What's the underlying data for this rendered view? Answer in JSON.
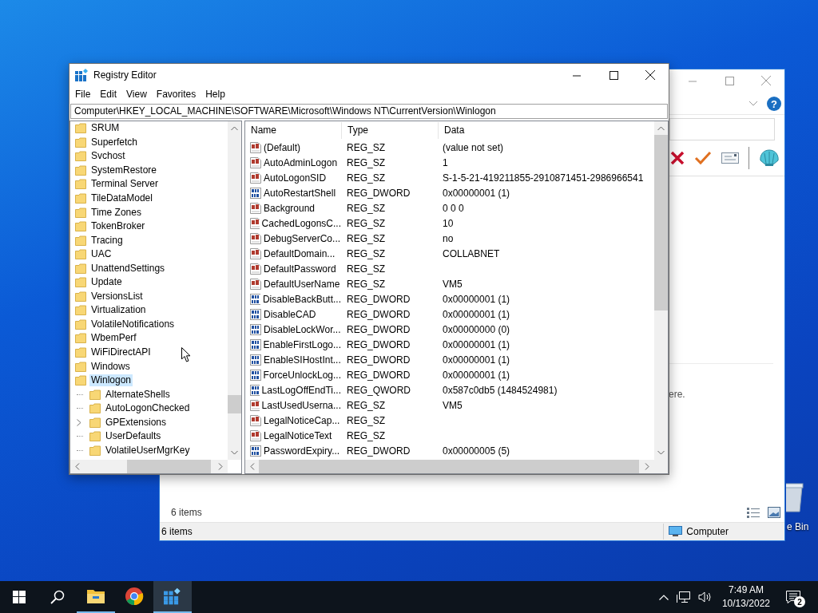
{
  "desktop": {
    "icon_label": "e Bin"
  },
  "background_window": {
    "help_glyph": "?",
    "hint_fragment": "ere.",
    "item_count": "6 items",
    "status_bar": {
      "items": "6 items",
      "location": "Computer"
    }
  },
  "registry_editor": {
    "title": "Registry Editor",
    "menu": [
      "File",
      "Edit",
      "View",
      "Favorites",
      "Help"
    ],
    "address": "Computer\\HKEY_LOCAL_MACHINE\\SOFTWARE\\Microsoft\\Windows NT\\CurrentVersion\\Winlogon",
    "tree": [
      {
        "label": "SRUM",
        "selected": false
      },
      {
        "label": "Superfetch",
        "selected": false
      },
      {
        "label": "Svchost",
        "selected": false
      },
      {
        "label": "SystemRestore",
        "selected": false
      },
      {
        "label": "Terminal Server",
        "selected": false
      },
      {
        "label": "TileDataModel",
        "selected": false
      },
      {
        "label": "Time Zones",
        "selected": false
      },
      {
        "label": "TokenBroker",
        "selected": false
      },
      {
        "label": "Tracing",
        "selected": false
      },
      {
        "label": "UAC",
        "selected": false
      },
      {
        "label": "UnattendSettings",
        "selected": false
      },
      {
        "label": "Update",
        "selected": false
      },
      {
        "label": "VersionsList",
        "selected": false
      },
      {
        "label": "Virtualization",
        "selected": false
      },
      {
        "label": "VolatileNotifications",
        "selected": false
      },
      {
        "label": "WbemPerf",
        "selected": false
      },
      {
        "label": "WiFiDirectAPI",
        "selected": false
      },
      {
        "label": "Windows",
        "selected": false
      },
      {
        "label": "Winlogon",
        "selected": true,
        "children": [
          {
            "label": "AlternateShells",
            "selected": false,
            "expandable": false
          },
          {
            "label": "AutoLogonChecked",
            "selected": false,
            "expandable": false
          },
          {
            "label": "GPExtensions",
            "selected": false,
            "expandable": true
          },
          {
            "label": "UserDefaults",
            "selected": false,
            "expandable": false
          },
          {
            "label": "VolatileUserMgrKey",
            "selected": false,
            "expandable": false
          }
        ]
      }
    ],
    "columns": [
      "Name",
      "Type",
      "Data"
    ],
    "rows": [
      {
        "kind": "string",
        "name": "(Default)",
        "type": "REG_SZ",
        "data": "(value not set)"
      },
      {
        "kind": "string",
        "name": "AutoAdminLogon",
        "type": "REG_SZ",
        "data": "1"
      },
      {
        "kind": "string",
        "name": "AutoLogonSID",
        "type": "REG_SZ",
        "data": "S-1-5-21-419211855-2910871451-2986966541"
      },
      {
        "kind": "number",
        "name": "AutoRestartShell",
        "type": "REG_DWORD",
        "data": "0x00000001 (1)"
      },
      {
        "kind": "string",
        "name": "Background",
        "type": "REG_SZ",
        "data": "0 0 0"
      },
      {
        "kind": "string",
        "name": "CachedLogonsC...",
        "type": "REG_SZ",
        "data": "10"
      },
      {
        "kind": "string",
        "name": "DebugServerCo...",
        "type": "REG_SZ",
        "data": "no"
      },
      {
        "kind": "string",
        "name": "DefaultDomain...",
        "type": "REG_SZ",
        "data": "COLLABNET"
      },
      {
        "kind": "string",
        "name": "DefaultPassword",
        "type": "REG_SZ"
      },
      {
        "kind": "string",
        "name": "DefaultUserName",
        "type": "REG_SZ",
        "data": "VM5"
      },
      {
        "kind": "number",
        "name": "DisableBackButt...",
        "type": "REG_DWORD",
        "data": "0x00000001 (1)"
      },
      {
        "kind": "number",
        "name": "DisableCAD",
        "type": "REG_DWORD",
        "data": "0x00000001 (1)"
      },
      {
        "kind": "number",
        "name": "DisableLockWor...",
        "type": "REG_DWORD",
        "data": "0x00000000 (0)"
      },
      {
        "kind": "number",
        "name": "EnableFirstLogo...",
        "type": "REG_DWORD",
        "data": "0x00000001 (1)"
      },
      {
        "kind": "number",
        "name": "EnableSIHostInt...",
        "type": "REG_DWORD",
        "data": "0x00000001 (1)"
      },
      {
        "kind": "number",
        "name": "ForceUnlockLog...",
        "type": "REG_DWORD",
        "data": "0x00000001 (1)"
      },
      {
        "kind": "number",
        "name": "LastLogOffEndTi...",
        "type": "REG_QWORD",
        "data": "0x587c0db5 (1484524981)"
      },
      {
        "kind": "string",
        "name": "LastUsedUserna...",
        "type": "REG_SZ",
        "data": "VM5"
      },
      {
        "kind": "string",
        "name": "LegalNoticeCap...",
        "type": "REG_SZ"
      },
      {
        "kind": "string",
        "name": "LegalNoticeText",
        "type": "REG_SZ"
      },
      {
        "kind": "number",
        "name": "PasswordExpiry...",
        "type": "REG_DWORD",
        "data": "0x00000005 (5)"
      }
    ]
  },
  "taskbar": {
    "apps": [
      {
        "kind": "explorer",
        "running": true,
        "selected": false
      },
      {
        "kind": "browser",
        "running": false,
        "selected": false
      },
      {
        "kind": "registry",
        "running": true,
        "selected": true
      }
    ],
    "time": "7:49 AM",
    "date": "10/13/2022",
    "notification_count": "2"
  }
}
